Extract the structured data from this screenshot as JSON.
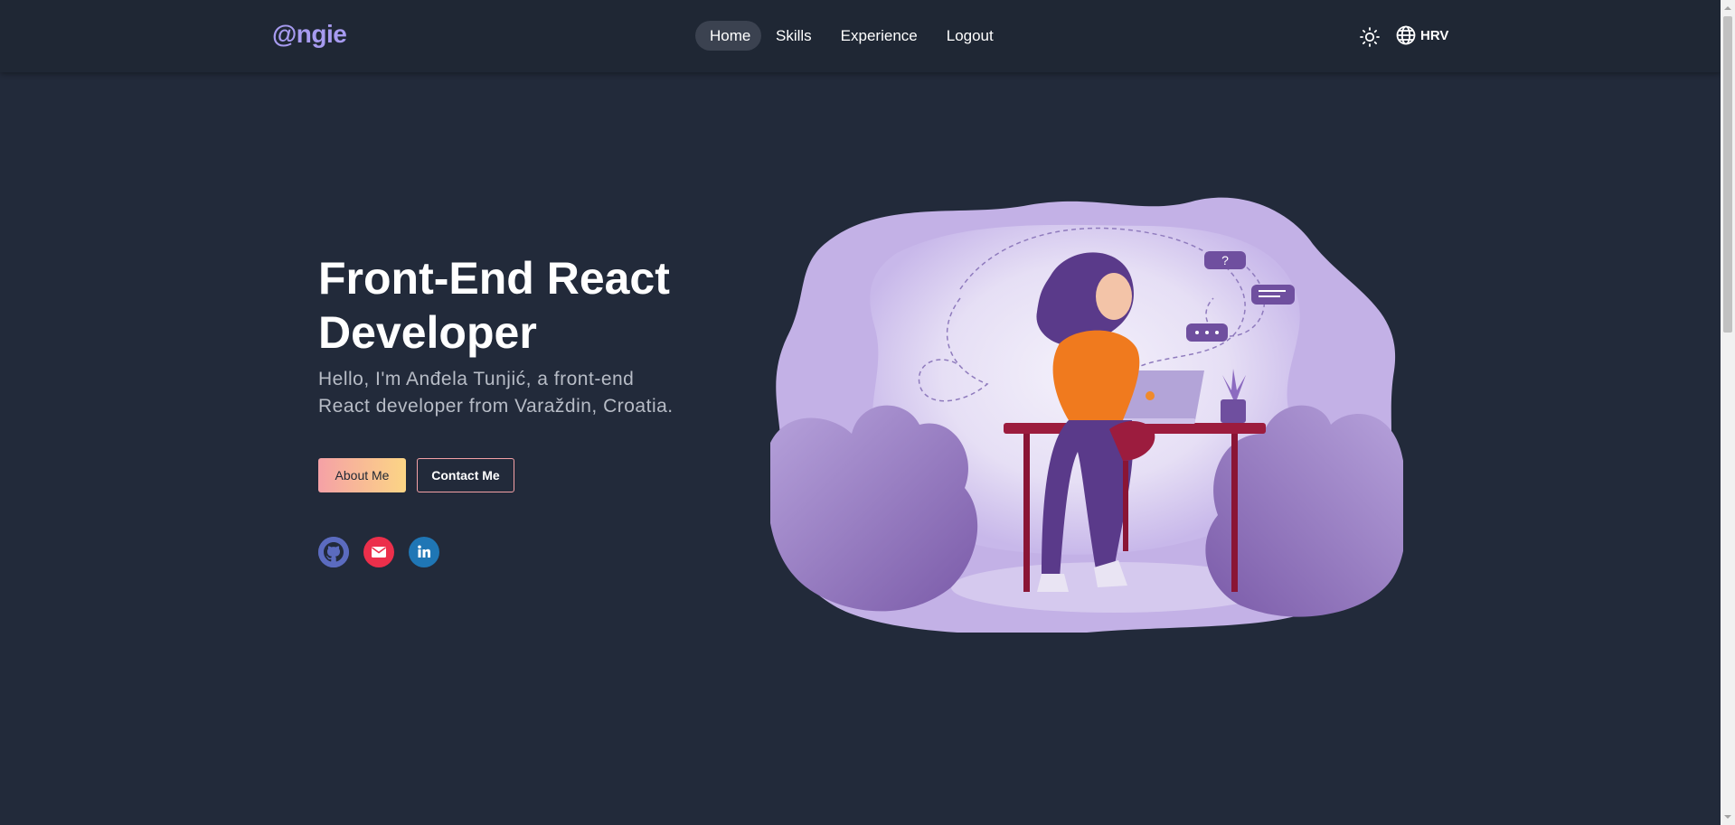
{
  "logo": "@ngie",
  "nav": {
    "links": [
      "Home",
      "Skills",
      "Experience",
      "Logout"
    ],
    "active": "Home"
  },
  "toolbar": {
    "theme_icon": "sun-icon",
    "language_icon": "globe-icon",
    "language_label": "HRV"
  },
  "hero": {
    "title": "Front-End React Developer",
    "subtitle": "Hello, I'm Anđela Tunjić, a front-end React developer from Varaždin, Croatia.",
    "about_button": "About Me",
    "contact_button": "Contact Me"
  },
  "social": [
    {
      "icon": "github-icon",
      "color": "#5b6bbf"
    },
    {
      "icon": "mail-icon",
      "color": "#ec2f4b"
    },
    {
      "icon": "linkedin-icon",
      "color": "#1f76b5",
      "text": "in"
    }
  ],
  "colors": {
    "background": "#222a3a",
    "navbar": "#1f2734",
    "logo": "#a79bf0",
    "accent_pink": "#f5a1a6",
    "accent_yellow": "#fcd585"
  }
}
